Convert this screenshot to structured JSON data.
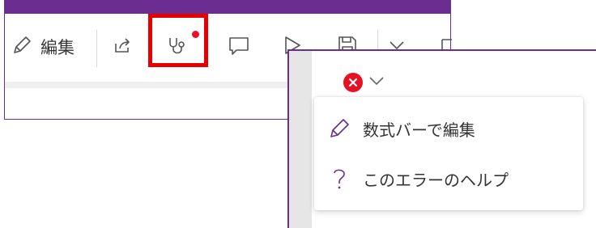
{
  "colors": {
    "accent": "#6b2d91",
    "error": "#e81123",
    "highlight": "#e60000"
  },
  "toolbar": {
    "edit_label": "編集",
    "icons": [
      "pencil-icon",
      "share-icon",
      "stethoscope-icon",
      "comment-icon",
      "play-icon",
      "save-icon",
      "chevron-down-icon",
      "more-icon"
    ]
  },
  "error_menu": {
    "items": [
      {
        "icon": "pencil-icon",
        "label": "数式バーで編集"
      },
      {
        "icon": "question-icon",
        "label": "このエラーのヘルプ"
      }
    ]
  }
}
